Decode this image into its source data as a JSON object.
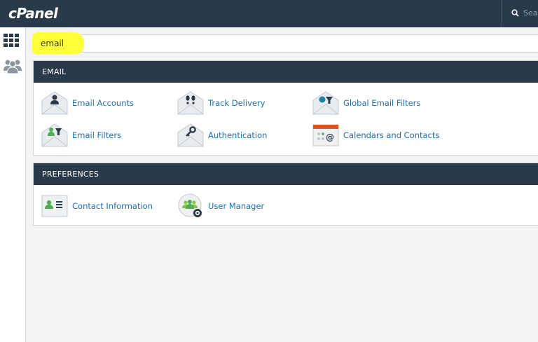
{
  "header": {
    "logo": "cPanel",
    "search_placeholder": "Sear"
  },
  "search": {
    "value": "email"
  },
  "sections": [
    {
      "title": "EMAIL",
      "items": [
        {
          "label": "Email Accounts",
          "icon": "email-accounts-icon"
        },
        {
          "label": "Track Delivery",
          "icon": "track-delivery-icon"
        },
        {
          "label": "Global Email Filters",
          "icon": "global-email-filters-icon"
        },
        {
          "label": "Email Filters",
          "icon": "email-filters-icon"
        },
        {
          "label": "Authentication",
          "icon": "authentication-icon"
        },
        {
          "label": "Calendars and Contacts",
          "icon": "calendars-contacts-icon"
        }
      ]
    },
    {
      "title": "PREFERENCES",
      "items": [
        {
          "label": "Contact Information",
          "icon": "contact-information-icon"
        },
        {
          "label": "User Manager",
          "icon": "user-manager-icon"
        }
      ]
    }
  ],
  "colors": {
    "header": "#293a4a",
    "link": "#1f6fb5",
    "highlight": "#ffff3a",
    "accent_green": "#4caf50",
    "accent_teal": "#1e7f9e",
    "accent_orange": "#e0531f"
  }
}
